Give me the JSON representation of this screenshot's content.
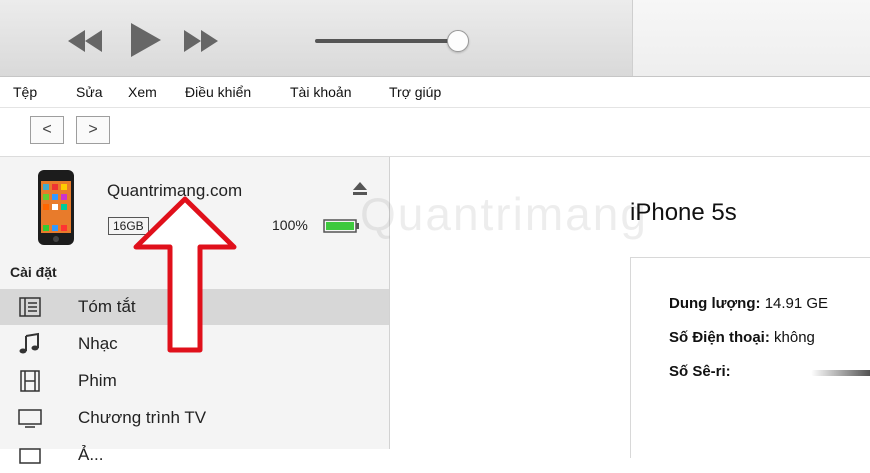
{
  "toolbar": {
    "icons": [
      "rewind-icon",
      "play-icon",
      "fast-forward-icon",
      "volume-slider"
    ]
  },
  "menu": [
    "Tệp",
    "Sửa",
    "Xem",
    "Điều khiển",
    "Tài khoản",
    "Trợ giúp"
  ],
  "nav": {
    "back": "<",
    "forward": ">"
  },
  "device": {
    "name": "Quantrimang.com",
    "capacity": "16GB",
    "battery": "100%"
  },
  "sidebar": {
    "section": "Cài đặt",
    "items": [
      {
        "label": "Tóm tắt",
        "icon": "list-icon"
      },
      {
        "label": "Nhạc",
        "icon": "music-note-icon"
      },
      {
        "label": "Phim",
        "icon": "film-icon"
      },
      {
        "label": "Chương trình TV",
        "icon": "tv-icon"
      },
      {
        "label": "Ả...",
        "icon": "photo-icon"
      }
    ]
  },
  "main": {
    "title": "iPhone 5s",
    "rows": [
      {
        "key": "Dung lượng:",
        "value": "14.91 GE"
      },
      {
        "key": "Số Điện thoại:",
        "value": "không"
      },
      {
        "key": "Số Sê-ri:",
        "value": ""
      }
    ]
  },
  "watermark": "Quantrimang",
  "colors": {
    "arrow": "#e0101b",
    "battery": "#3ec93e"
  }
}
